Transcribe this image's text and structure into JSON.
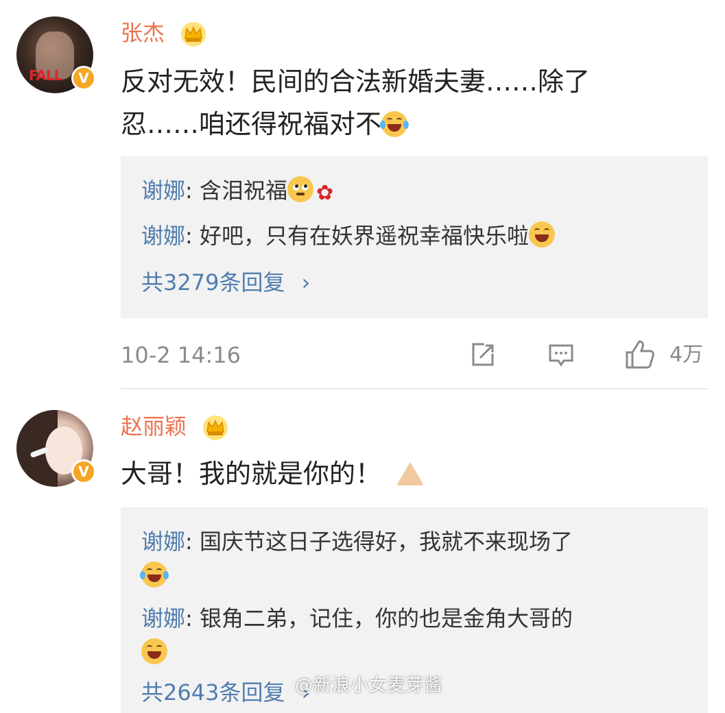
{
  "comments": [
    {
      "user": "张杰",
      "text_line1": "反对无效！民间的合法新婚夫妻……除了",
      "text_line2": "忍……咱还得祝福对不",
      "replies": [
        {
          "who": "谢娜",
          "sep": ": ",
          "text": "含泪祝福"
        },
        {
          "who": "谢娜",
          "sep": ": ",
          "text": "好吧，只有在妖界遥祝幸福快乐啦"
        }
      ],
      "reply_count": "共3279条回复",
      "timestamp": "10-2 14:16",
      "like_count": "4万"
    },
    {
      "user": "赵丽颖",
      "text": "大哥！我的就是你的！",
      "replies": [
        {
          "who": "谢娜",
          "sep": ": ",
          "text": "国庆节这日子选得好，我就不来现场了"
        },
        {
          "who": "谢娜",
          "sep": ": ",
          "text": "银角二弟，记住，你的也是金角大哥的"
        }
      ],
      "reply_count": "共2643条回复"
    }
  ],
  "verified_mark": "V",
  "chevron": "›",
  "watermark": "@新浪小女麦芽酱",
  "colors": {
    "username": "#eb7350",
    "reply_name": "#507daf",
    "reply_bg": "#f2f2f2",
    "meta_gray": "#8a8a8a",
    "verified": "#f5a623"
  },
  "icons": [
    "crown-icon",
    "laugh-cry-emoji",
    "sad-emoji",
    "rose-icon",
    "grin-emoji",
    "share-icon",
    "comment-icon",
    "like-icon",
    "pray-hands-emoji"
  ]
}
